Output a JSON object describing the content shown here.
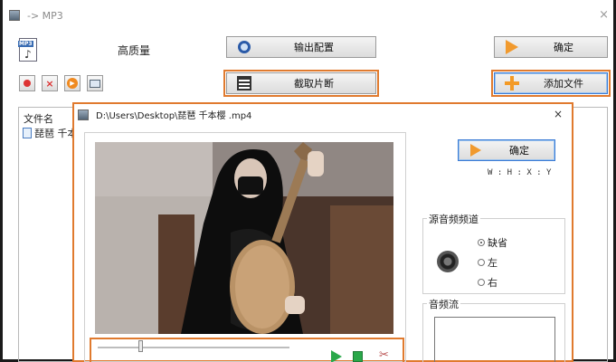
{
  "main_window": {
    "title": "-> MP3",
    "close_glyph": "×",
    "quality_label": "高质量",
    "buttons": {
      "output_config": "输出配置",
      "confirm": "确定",
      "clip": "截取片断",
      "add_file": "添加文件"
    },
    "list": {
      "header": "文件名",
      "rows": [
        "琵琶 千本"
      ]
    }
  },
  "dialog": {
    "title": "D:\\Users\\Desktop\\琵琶 千本樱 .mp4",
    "close_glyph": "×",
    "confirm": "确定",
    "coords": "W : H : X : Y",
    "audio_group": {
      "legend": "源音频频道",
      "options": [
        "缺省",
        "左",
        "右"
      ],
      "selected": "缺省"
    },
    "stream_group": {
      "legend": "音频流"
    }
  },
  "colors": {
    "highlight": "#e07a2e",
    "accent_blue": "#3a7bd5",
    "play_green": "#2aa84a"
  },
  "icons": [
    "app-icon",
    "mp3-file-icon",
    "gear-icon",
    "arrow-right-icon",
    "film-icon",
    "plus-icon",
    "play-icon",
    "stop-icon",
    "scissors-icon",
    "speaker-icon"
  ]
}
